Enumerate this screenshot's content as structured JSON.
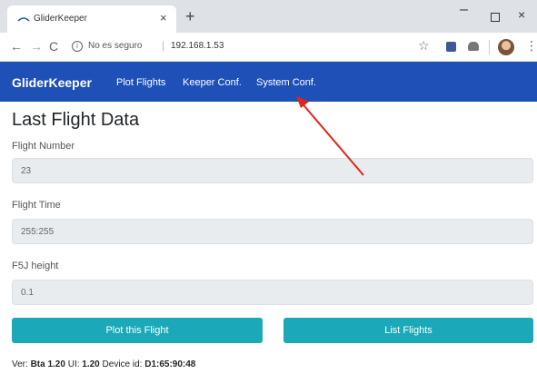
{
  "browser": {
    "tab_title": "GliderKeeper",
    "tab_close": "×",
    "new_tab": "+",
    "window_min": "–",
    "window_close": "×",
    "security_label": "No es seguro",
    "separator": "|",
    "url": "192.168.1.53"
  },
  "navbar": {
    "brand": "GliderKeeper",
    "links": [
      "Plot Flights",
      "Keeper Conf.",
      "System Conf."
    ]
  },
  "main": {
    "title": "Last Flight Data",
    "fields": [
      {
        "label": "Flight Number",
        "value": "23"
      },
      {
        "label": "Flight Time",
        "value": "255:255"
      },
      {
        "label": "F5J height",
        "value": "0.1"
      }
    ],
    "buttons": {
      "plot": "Plot this Flight",
      "list": "List Flights"
    }
  },
  "footer": {
    "ver_label": "Ver:",
    "ver_value": "Bta 1.20",
    "ui_label": "UI:",
    "ui_value": "1.20",
    "device_label": "Device id:",
    "device_value": "D1:65:90:48"
  },
  "colors": {
    "navbar": "#1e50b8",
    "button": "#1ba8b8",
    "annotation_arrow": "#e0261a"
  }
}
